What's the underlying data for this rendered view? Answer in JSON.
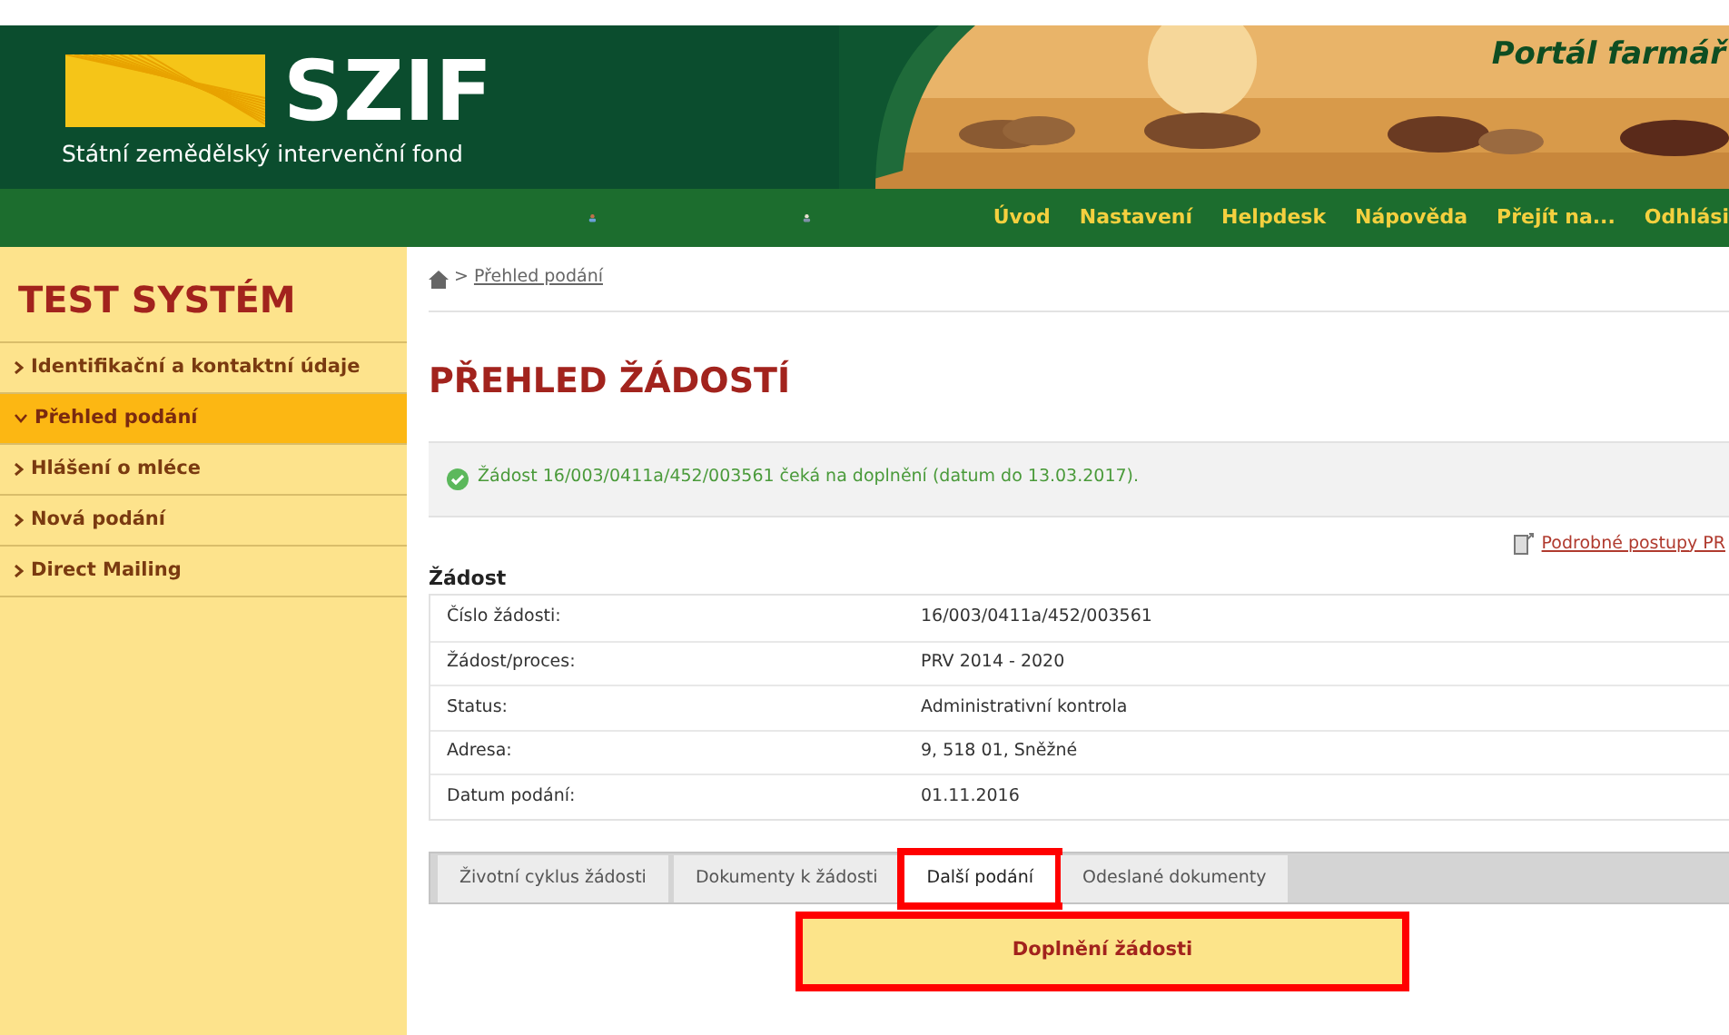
{
  "header": {
    "logo": "SZIF",
    "subtitle": "Státní zemědělský intervenční fond",
    "portal": "Portál farmář"
  },
  "nav": [
    "Úvod",
    "Nastavení",
    "Helpdesk",
    "Nápověda",
    "Přejít na...",
    "Odhlási"
  ],
  "sidebar": {
    "title": "TEST SYSTÉM",
    "items": [
      {
        "label": "Identifikační a kontaktní údaje",
        "selected": false
      },
      {
        "label": "Přehled podání",
        "selected": true
      },
      {
        "label": "Hlášení o mléce",
        "selected": false
      },
      {
        "label": "Nová podání",
        "selected": false
      },
      {
        "label": "Direct Mailing",
        "selected": false
      }
    ]
  },
  "breadcrumb_separator": ">",
  "breadcrumb": "Přehled podání",
  "heading": "PŘEHLED ŽÁDOSTÍ",
  "notice": "Žádost 16/003/0411a/452/003561 čeká na doplnění (datum do 13.03.2017).",
  "procedures_link": "Podrobné postupy PR",
  "section_title": "Žádost",
  "details": [
    {
      "label": "Číslo žádosti:",
      "value": "16/003/0411a/452/003561"
    },
    {
      "label": "Žádost/proces:",
      "value": "PRV 2014 - 2020"
    },
    {
      "label": "Status:",
      "value": "Administrativní kontrola"
    },
    {
      "label": "Adresa:",
      "value": "9, 518 01, Sněžné"
    },
    {
      "label": "Datum podání:",
      "value": "01.11.2016"
    }
  ],
  "tabs": [
    {
      "label": "Životní cyklus žádosti",
      "selected": false,
      "highlighted": false
    },
    {
      "label": "Dokumenty k žádosti",
      "selected": false,
      "highlighted": false
    },
    {
      "label": "Další podání",
      "selected": true,
      "highlighted": true
    },
    {
      "label": "Odeslané dokumenty",
      "selected": false,
      "highlighted": false
    }
  ],
  "action_button": {
    "label": "Doplnění žádosti",
    "highlighted": true
  }
}
